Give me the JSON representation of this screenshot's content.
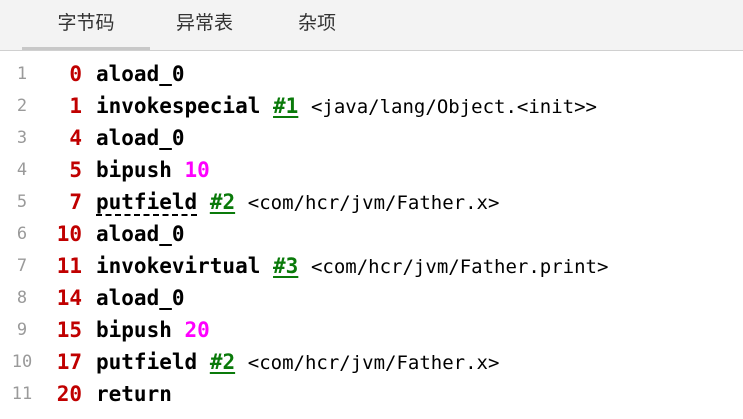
{
  "tabs": [
    {
      "label": "字节码",
      "active": true
    },
    {
      "label": "异常表",
      "active": false
    },
    {
      "label": "杂项",
      "active": false
    }
  ],
  "colors": {
    "offset": "#c00000",
    "instruction": "#000000",
    "constant_ref": "#0a7a0a",
    "immediate": "#ff00ff",
    "line_number": "#9a9a9a"
  },
  "code": [
    {
      "line": "1",
      "offset": "0",
      "instr": "aload_0",
      "ref": "",
      "num": "",
      "comment": ""
    },
    {
      "line": "2",
      "offset": "1",
      "instr": "invokespecial",
      "ref": "#1",
      "num": "",
      "comment": "<java/lang/Object.<init>>"
    },
    {
      "line": "3",
      "offset": "4",
      "instr": "aload_0",
      "ref": "",
      "num": "",
      "comment": ""
    },
    {
      "line": "4",
      "offset": "5",
      "instr": "bipush",
      "ref": "",
      "num": "10",
      "comment": ""
    },
    {
      "line": "5",
      "offset": "7",
      "instr": "putfield",
      "ref": "#2",
      "num": "",
      "comment": "<com/hcr/jvm/Father.x>"
    },
    {
      "line": "6",
      "offset": "10",
      "instr": "aload_0",
      "ref": "",
      "num": "",
      "comment": ""
    },
    {
      "line": "7",
      "offset": "11",
      "instr": "invokevirtual",
      "ref": "#3",
      "num": "",
      "comment": "<com/hcr/jvm/Father.print>"
    },
    {
      "line": "8",
      "offset": "14",
      "instr": "aload_0",
      "ref": "",
      "num": "",
      "comment": ""
    },
    {
      "line": "9",
      "offset": "15",
      "instr": "bipush",
      "ref": "",
      "num": "20",
      "comment": ""
    },
    {
      "line": "10",
      "offset": "17",
      "instr": "putfield",
      "ref": "#2",
      "num": "",
      "comment": "<com/hcr/jvm/Father.x>"
    },
    {
      "line": "11",
      "offset": "20",
      "instr": "return",
      "ref": "",
      "num": "",
      "comment": ""
    }
  ]
}
